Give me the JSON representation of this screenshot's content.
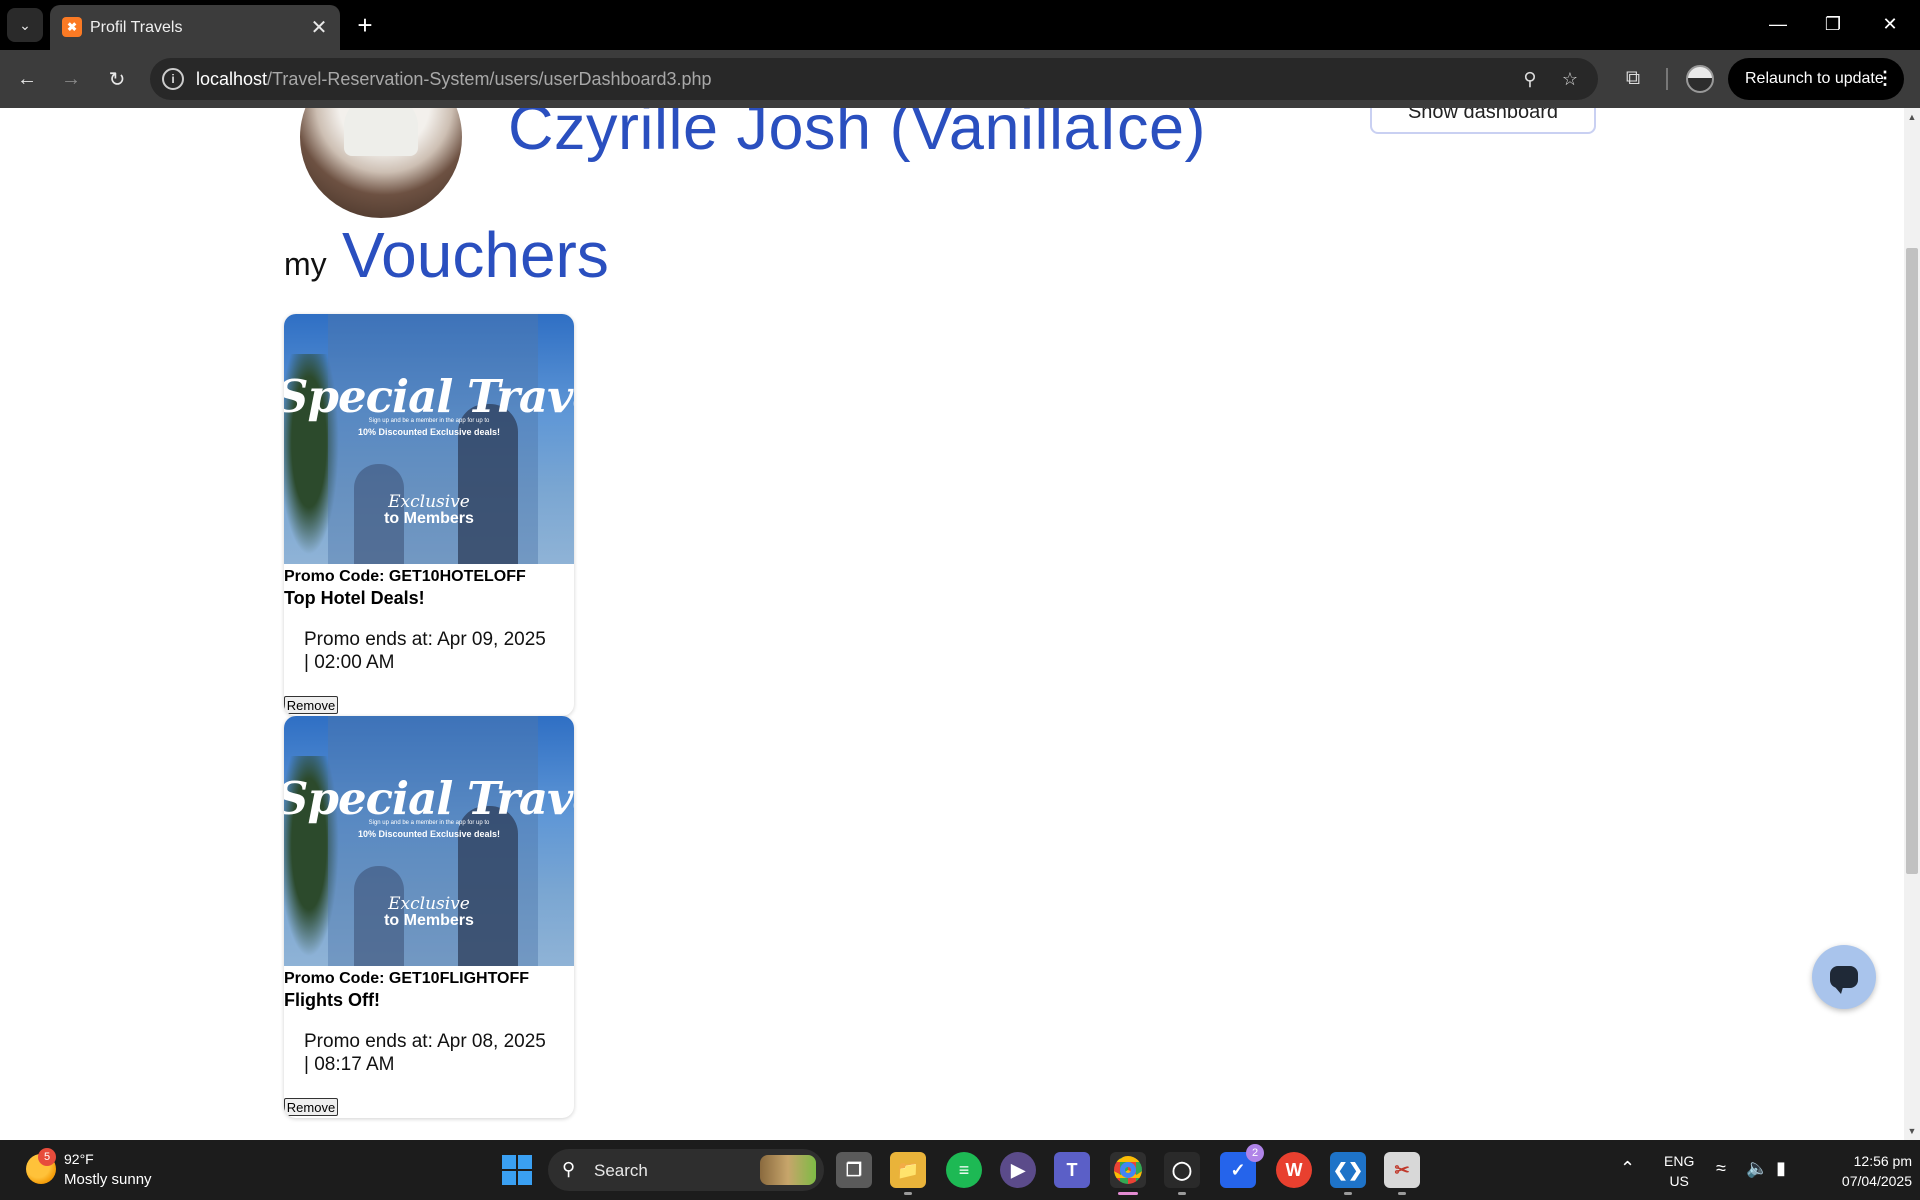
{
  "browser": {
    "tab_title": "Profil Travels",
    "url_host": "localhost",
    "url_path": "/Travel-Reservation-System/users/userDashboard3.php",
    "relaunch_label": "Relaunch to update"
  },
  "profile": {
    "name": "Czyrille Josh (VanillaIce)",
    "show_dashboard_label": "Show dashboard"
  },
  "vouchers_section": {
    "prefix": "my",
    "title": "Vouchers"
  },
  "vouchers": [
    {
      "poster_title": "Special Travel Offers",
      "poster_line1": "Sign up and be a member in the app for up to",
      "poster_line2": "10% Discounted Exclusive deals!",
      "poster_excl": "Exclusive",
      "poster_members": "to Members",
      "promo_code": "Promo Code: GET10HOTELOFF",
      "title": "Top Hotel Deals!",
      "ends": "Promo ends at: Apr 09, 2025 | 02:00 AM",
      "remove_label": "Remove"
    },
    {
      "poster_title": "Special Travel Offers",
      "poster_line1": "Sign up and be a member in the app for up to",
      "poster_line2": "10% Discounted Exclusive deals!",
      "poster_excl": "Exclusive",
      "poster_members": "to Members",
      "promo_code": "Promo Code: GET10FLIGHTOFF",
      "title": "Flights Off!",
      "ends": "Promo ends at: Apr 08, 2025 | 08:17 AM",
      "remove_label": "Remove"
    }
  ],
  "taskbar": {
    "weather_badge": "5",
    "weather_temp": "92°F",
    "weather_desc": "Mostly sunny",
    "search_label": "Search",
    "todo_badge": "2",
    "lang_line1": "ENG",
    "lang_line2": "US",
    "time": "12:56 pm",
    "date": "07/04/2025"
  },
  "colors": {
    "accent_blue": "#2a4fbf",
    "chrome_dark": "#3c3c3c",
    "taskbar": "#1c1c1c",
    "chat_fab": "#a9c4ec"
  },
  "icons": {
    "favicon": "xampp-icon",
    "back": "arrow-left-icon",
    "forward": "arrow-right-icon",
    "reload": "reload-icon",
    "zoom": "zoom-icon",
    "bookmark": "star-icon",
    "extensions": "puzzle-icon",
    "chat": "chat-bubble-icon"
  }
}
